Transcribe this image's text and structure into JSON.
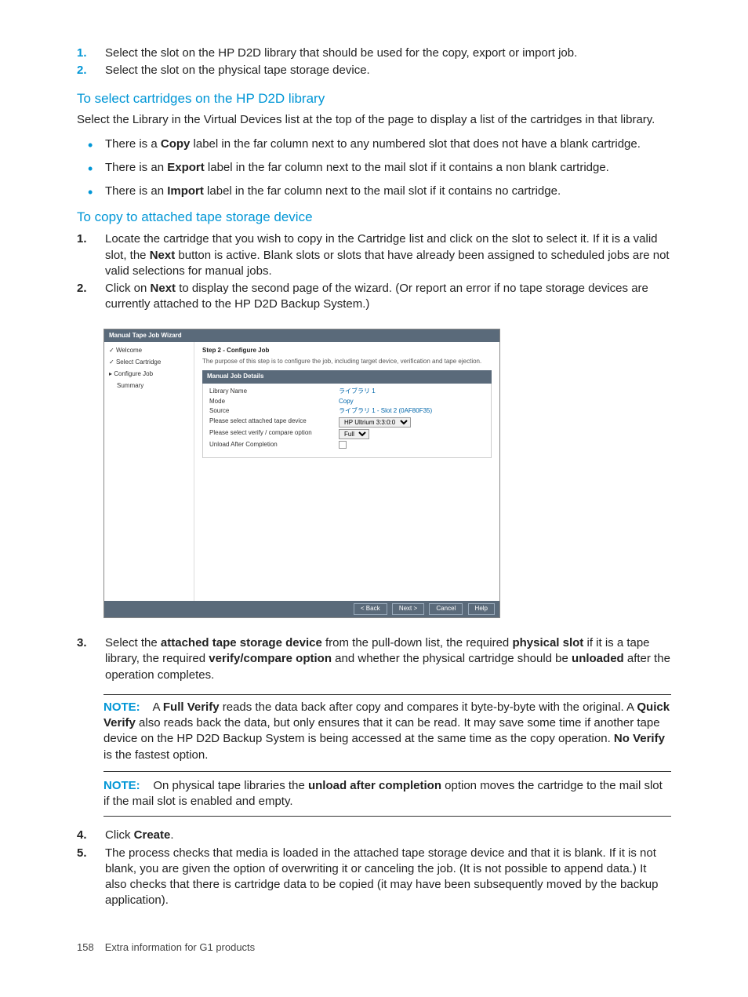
{
  "topList": [
    {
      "n": "1.",
      "txt": "Select the slot on the HP D2D library that should be used for the copy, export or import job."
    },
    {
      "n": "2.",
      "txt": "Select the slot on the physical tape storage device."
    }
  ],
  "sect1": {
    "title": "To select cartridges on the HP D2D library",
    "para": "Select the Library in the Virtual Devices list at the top of the page to display a list of the cartridges in that library.",
    "bullets": [
      {
        "pre": "There is a ",
        "b": "Copy",
        "post": " label in the far column next to any numbered slot that does not have a blank cartridge."
      },
      {
        "pre": "There is an ",
        "b": "Export",
        "post": " label in the far column next to the mail slot if it contains a non blank cartridge."
      },
      {
        "pre": "There is an ",
        "b": "Import",
        "post": " label in the far column next to the mail slot if it contains no cartridge."
      }
    ]
  },
  "sect2": {
    "title": "To copy to attached tape storage device",
    "step1": {
      "n": "1.",
      "a": "Locate the cartridge that you wish to copy in the Cartridge list and click on the slot to select it. If it is a valid slot, the ",
      "b": "Next",
      "c": " button is active. Blank slots or slots that have already been assigned to scheduled jobs are not valid selections for manual jobs."
    },
    "step2": {
      "n": "2.",
      "a": "Click on ",
      "b": "Next",
      "c": " to display the second page of the wizard. (Or report an error if no tape storage devices are currently attached to the HP D2D Backup System.)"
    }
  },
  "ui": {
    "title": "Manual Tape Job Wizard",
    "side": {
      "welcome": "Welcome",
      "select": "Select Cartridge",
      "configure": "Configure Job",
      "summary": "Summary"
    },
    "step": "Step 2 - Configure Job",
    "desc": "The purpose of this step is to configure the job, including target device, verification and tape ejection.",
    "panel": "Manual Job Details",
    "rows": {
      "libname_l": "Library Name",
      "libname_v": "ライブラリ 1",
      "mode_l": "Mode",
      "mode_v": "Copy",
      "source_l": "Source",
      "source_v": "ライブラリ 1 - Slot 2 (0AF80F35)",
      "tape_l": "Please select attached tape device",
      "tape_v": "HP Ultrium 3:3:0:0",
      "verify_l": "Please select verify / compare option",
      "verify_v": "Full",
      "unload_l": "Unload After Completion"
    },
    "btn": {
      "back": "< Back",
      "next": "Next >",
      "cancel": "Cancel",
      "help": "Help"
    }
  },
  "step3": {
    "n": "3.",
    "a": "Select the ",
    "b1": "attached tape storage device",
    "c": " from the pull-down list, the required ",
    "b2": "physical slot",
    "d": " if it is a tape library, the required ",
    "b3": "verify/compare option",
    "e": " and whether the physical cartridge should be ",
    "b4": "unloaded",
    "f": " after the operation completes."
  },
  "note1": {
    "label": "NOTE:",
    "a": " A ",
    "b1": "Full Verify",
    "c": " reads the data back after copy and compares it byte-by-byte with the original. A ",
    "b2": "Quick Verify",
    "d": " also reads back the data, but only ensures that it can be read. It may save some time if another tape device on the HP D2D Backup System is being accessed at the same time as the copy operation. ",
    "b3": "No Verify",
    "e": " is the fastest option."
  },
  "note2": {
    "label": "NOTE:",
    "a": " On physical tape libraries the ",
    "b1": "unload after completion",
    "c": " option moves the cartridge to the mail slot if the mail slot is enabled and empty."
  },
  "step4": {
    "n": "4.",
    "a": "Click ",
    "b": "Create",
    "c": "."
  },
  "step5": {
    "n": "5.",
    "txt": "The process checks that media is loaded in the attached tape storage device and that it is blank. If it is not blank, you are given the option of overwriting it or canceling the job. (It is not possible to append data.) It also checks that there is cartridge data to be copied (it may have been subsequently moved by the backup application)."
  },
  "footer": {
    "page": "158",
    "text": "Extra information for G1 products"
  }
}
